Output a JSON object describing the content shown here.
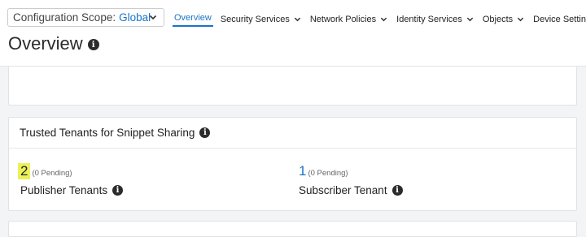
{
  "header": {
    "scope_label": "Configuration Scope:",
    "scope_value": "Global",
    "nav": [
      {
        "label": "Overview",
        "active": true
      },
      {
        "label": "Security Services"
      },
      {
        "label": "Network Policies"
      },
      {
        "label": "Identity Services"
      },
      {
        "label": "Objects"
      },
      {
        "label": "Device Setting"
      }
    ]
  },
  "page": {
    "title": "Overview"
  },
  "trusted_tenants": {
    "title": "Trusted Tenants for Snippet Sharing",
    "publisher": {
      "count": "2",
      "pending": "(0 Pending)",
      "label": "Publisher Tenants"
    },
    "subscriber": {
      "count": "1",
      "pending": "(0 Pending)",
      "label": "Subscriber Tenant"
    }
  },
  "colors": {
    "accent": "#1a73c8",
    "highlight": "#ecf15a"
  },
  "icons": {
    "info": "info-icon",
    "chevron": "chevron-down-icon"
  }
}
